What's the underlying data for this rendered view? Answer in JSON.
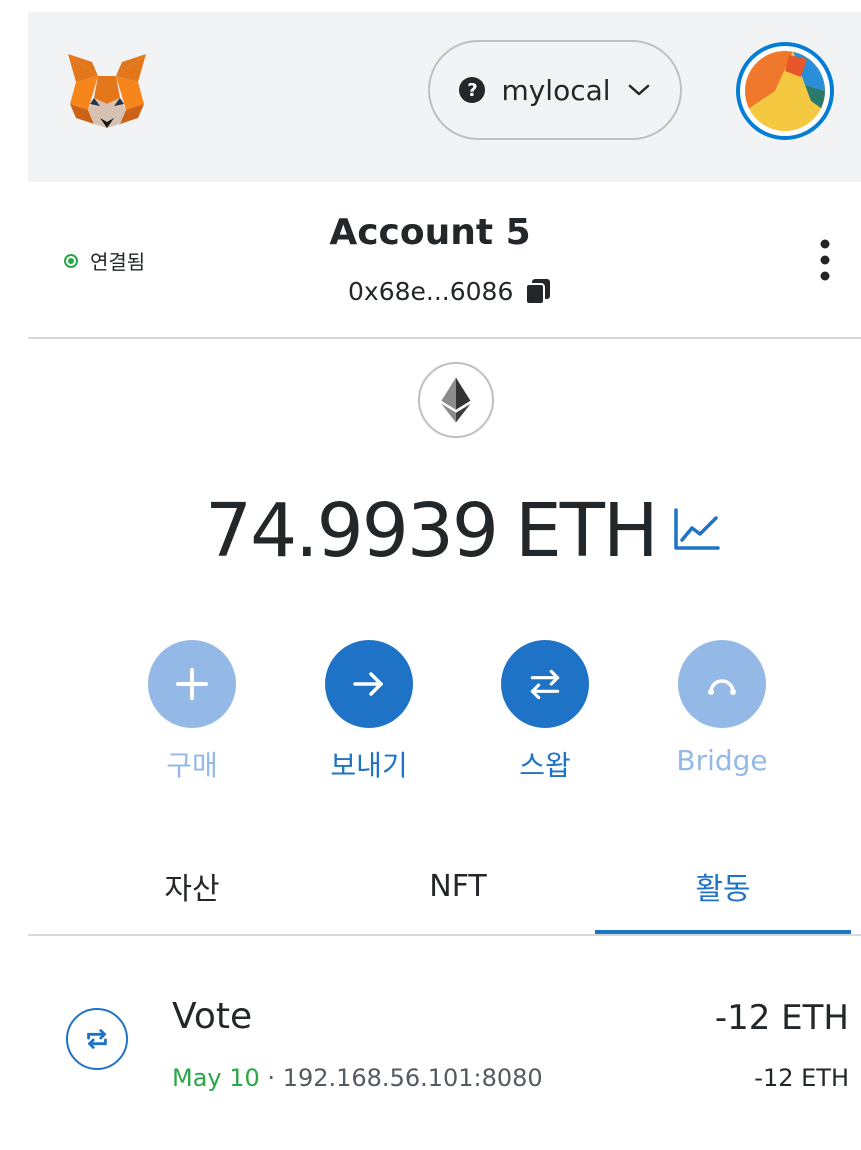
{
  "header": {
    "logo_icon": "metamask-fox-icon",
    "network": {
      "name": "mylocal",
      "icon": "question-icon",
      "chevron": "chevron-down-icon"
    },
    "avatar_icon": "account-avatar-icon"
  },
  "account": {
    "connection_status": "연결됨",
    "name": "Account 5",
    "address": "0x68e...6086",
    "copy_icon": "copy-icon",
    "menu_icon": "kebab-menu-icon"
  },
  "balance": {
    "asset_icon": "ethereum-icon",
    "amount": "74.9939",
    "unit": "ETH",
    "chart_icon": "portfolio-chart-icon"
  },
  "actions": [
    {
      "label": "구매",
      "icon": "plus-icon",
      "enabled": false
    },
    {
      "label": "보내기",
      "icon": "arrow-right-icon",
      "enabled": true
    },
    {
      "label": "스왑",
      "icon": "swap-icon",
      "enabled": true
    },
    {
      "label": "Bridge",
      "icon": "bridge-icon",
      "enabled": false
    }
  ],
  "tabs": [
    {
      "label": "자산",
      "active": false
    },
    {
      "label": "NFT",
      "active": false
    },
    {
      "label": "활동",
      "active": true
    }
  ],
  "activity": [
    {
      "title": "Vote",
      "date": "May 10",
      "separator": " · ",
      "origin": "192.168.56.101:8080",
      "amount_primary": "-12 ETH",
      "amount_secondary": "-12 ETH",
      "icon": "interaction-icon"
    }
  ],
  "colors": {
    "accent": "#1f73c6",
    "accent_disabled": "#94b9e6",
    "success": "#28a745",
    "text": "#24272a",
    "header_bg": "#f2f3f4"
  }
}
